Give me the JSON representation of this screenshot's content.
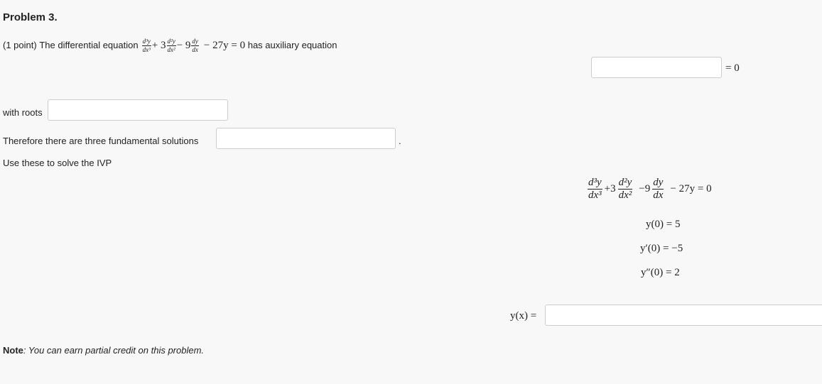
{
  "problem": {
    "title": "Problem 3.",
    "points": "(1 point)",
    "intro_text": "The differential equation",
    "aux_text": "has auxiliary equation",
    "equation": {
      "d3_num": "d³y",
      "d3_den": "dx³",
      "plus3": "+ 3",
      "d2_num": "d²y",
      "d2_den": "dx²",
      "minus9": "− 9",
      "d1_num": "dy",
      "d1_den": "dx",
      "tail": "− 27y = 0"
    },
    "aux_suffix": "= 0",
    "roots_label": "with roots",
    "fundamental_label": "Therefore there are three fundamental solutions",
    "fundamental_period": ".",
    "ivp_label": "Use these to solve the IVP"
  },
  "ivp": {
    "ode": {
      "d3_num": "d³y",
      "d3_den": "dx³",
      "plus3": "+3",
      "d2_num": "d²y",
      "d2_den": "dx²",
      "minus9": "−9",
      "d1_num": "dy",
      "d1_den": "dx",
      "tail": "− 27y = 0"
    },
    "cond1": "y(0) = 5",
    "cond2": "y′(0) = −5",
    "cond3": "y″(0) = 2"
  },
  "answer": {
    "label": "y(x) ="
  },
  "inputs": {
    "aux_equation": "",
    "roots": "",
    "fundamental_solutions": "",
    "y_of_x": ""
  },
  "note": {
    "label": "Note",
    "body": ": You can earn partial credit on this problem."
  }
}
